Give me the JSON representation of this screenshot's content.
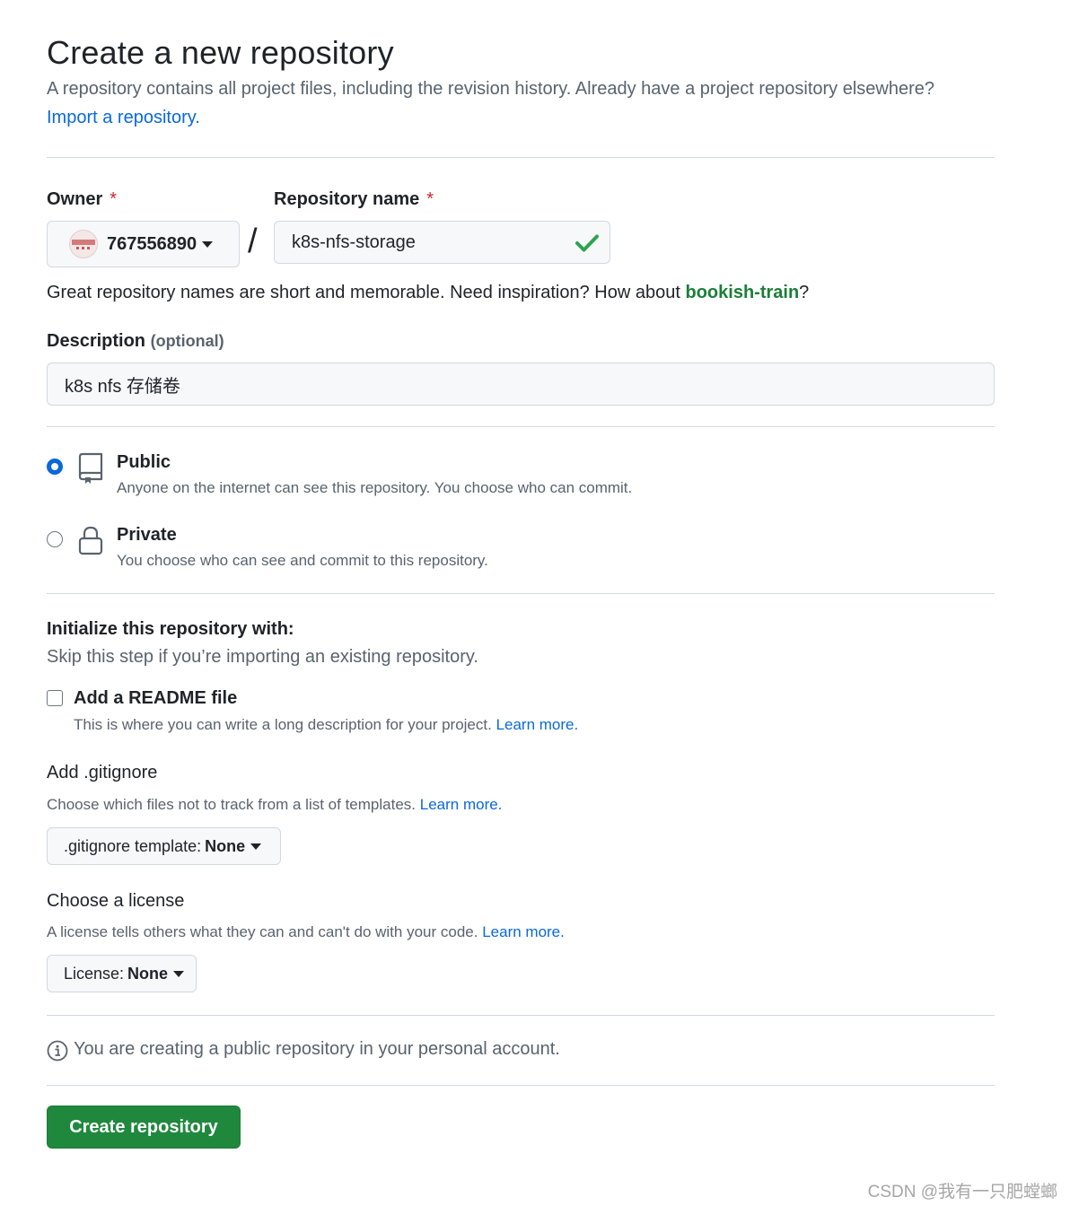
{
  "header": {
    "title": "Create a new repository",
    "subtitle": "A repository contains all project files, including the revision history. Already have a project repository elsewhere?",
    "import_link": "Import a repository."
  },
  "owner": {
    "label": "Owner",
    "required_mark": "*",
    "value": "767556890",
    "icon": "chevron-down-icon"
  },
  "separator": "/",
  "repo_name": {
    "label": "Repository name",
    "required_mark": "*",
    "value": "k8s-nfs-storage",
    "valid_icon": "check-icon"
  },
  "name_hint": {
    "text": "Great repository names are short and memorable. Need inspiration? How about ",
    "suggestion": "bookish-train",
    "suffix": "?"
  },
  "description": {
    "label": "Description",
    "optional": "(optional)",
    "value": "k8s nfs 存储卷"
  },
  "visibility": {
    "selected": "public",
    "public": {
      "title": "Public",
      "desc": "Anyone on the internet can see this repository. You choose who can commit."
    },
    "private": {
      "title": "Private",
      "desc": "You choose who can see and commit to this repository."
    }
  },
  "init": {
    "heading": "Initialize this repository with:",
    "sub": "Skip this step if you’re importing an existing repository.",
    "readme": {
      "label": "Add a README file",
      "checked": false,
      "desc": "This is where you can write a long description for your project.",
      "learn_more": "Learn more."
    }
  },
  "gitignore": {
    "heading": "Add .gitignore",
    "desc": "Choose which files not to track from a list of templates.",
    "learn_more": "Learn more.",
    "select_label": ".gitignore template:",
    "select_value": "None"
  },
  "license": {
    "heading": "Choose a license",
    "desc": "A license tells others what they can and can't do with your code.",
    "learn_more": "Learn more.",
    "select_label": "License:",
    "select_value": "None"
  },
  "notice": "You are creating a public repository in your personal account.",
  "submit": {
    "label": "Create repository"
  },
  "watermark": "CSDN @我有一只肥螳螂",
  "colors": {
    "accent": "#0969da",
    "success": "#1f883d",
    "required": "#d1242f",
    "muted_text": "#59636e"
  }
}
